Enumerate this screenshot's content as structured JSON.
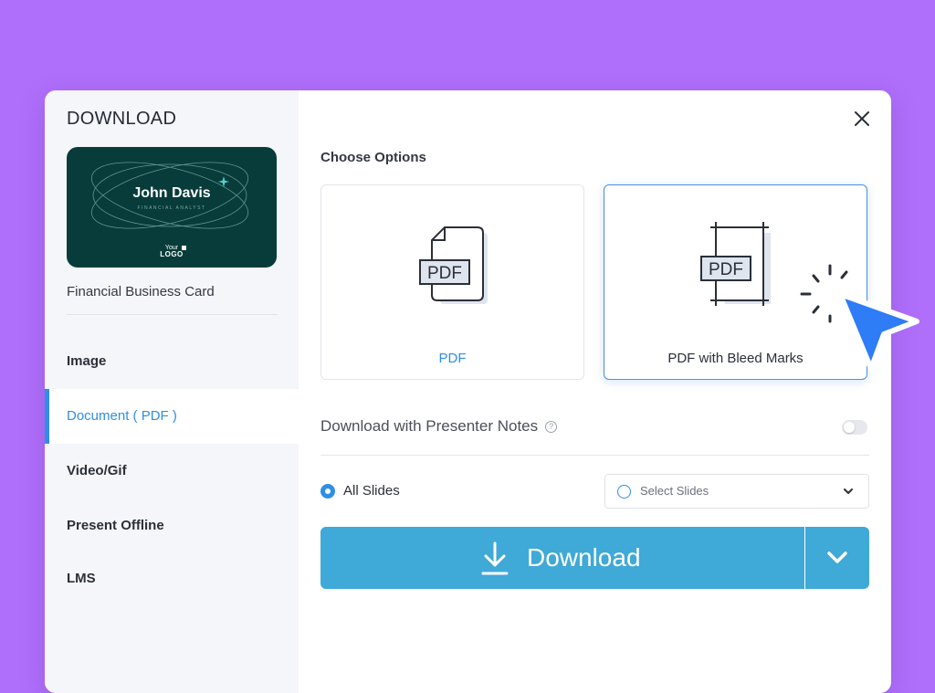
{
  "colors": {
    "background": "#b06ffb",
    "accent": "#2e8ee8",
    "download_button": "#3fa9d7",
    "card": "#073c3a"
  },
  "sidebar": {
    "title": "DOWNLOAD",
    "preview": {
      "name": "John Davis",
      "role": "FINANCIAL ANALYST",
      "logo_line1": "Your",
      "logo_line2": "LOGO"
    },
    "card_name": "Financial Business Card",
    "items": [
      {
        "label": "Image",
        "active": false
      },
      {
        "label": "Document ( PDF )",
        "active": true
      },
      {
        "label": "Video/Gif",
        "active": false
      },
      {
        "label": "Present Offline",
        "active": false
      },
      {
        "label": "LMS",
        "active": false
      }
    ]
  },
  "main": {
    "close_icon": "close-icon",
    "choose_options": "Choose Options",
    "options": [
      {
        "label": "PDF",
        "icon_text": "PDF",
        "icon": "pdf-file-icon",
        "selected": false
      },
      {
        "label": "PDF with Bleed Marks",
        "icon_text": "PDF",
        "icon": "pdf-bleed-marks-icon",
        "selected": true
      }
    ],
    "presenter_notes": {
      "label": "Download with Presenter Notes",
      "help": "?",
      "enabled": false
    },
    "slides": {
      "all_label": "All Slides",
      "select_placeholder": "Select Slides",
      "selected": "all"
    },
    "download": {
      "label": "Download"
    }
  }
}
